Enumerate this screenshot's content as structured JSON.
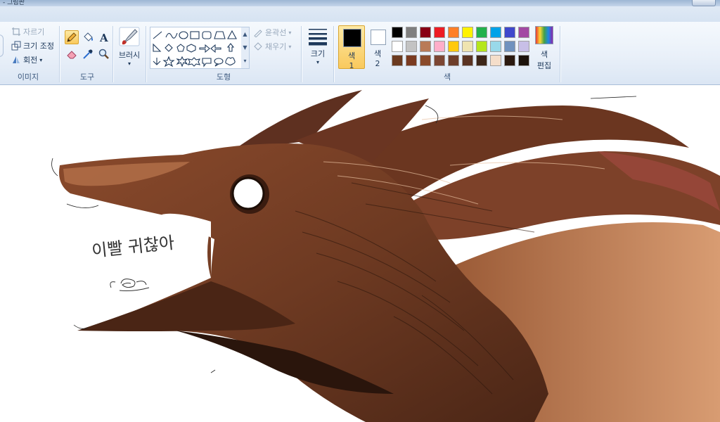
{
  "window": {
    "title": "- 그림판"
  },
  "ribbon": {
    "image_group": {
      "label": "이미지",
      "crop": "자르기",
      "resize": "크기 조정",
      "rotate": "회전"
    },
    "tools_group": {
      "label": "도구"
    },
    "brush": {
      "label": "브러시"
    },
    "shapes_group": {
      "label": "도형",
      "outline": "윤곽선",
      "fill": "채우기"
    },
    "size": {
      "label": "크기"
    },
    "colors_group": {
      "label": "색",
      "color1_label": "색",
      "color1_num": "1",
      "color2_label": "색",
      "color2_num": "2",
      "edit_label": "색",
      "edit_label2": "편집",
      "color1": "#000000",
      "color2": "#ffffff",
      "palette": [
        [
          "#000000",
          "#7f7f7f",
          "#880015",
          "#ed1c24",
          "#ff7f27",
          "#fff200",
          "#22b14c",
          "#00a2e8",
          "#3f48cc",
          "#a349a4"
        ],
        [
          "#ffffff",
          "#c3c3c3",
          "#b97a57",
          "#ffaec9",
          "#ffc90e",
          "#efe4b0",
          "#b5e61d",
          "#99d9ea",
          "#7092be",
          "#c8bfe7"
        ],
        [
          "#6b3a1f",
          "#7a3a20",
          "#8a4a2a",
          "#7c4633",
          "#6e3e2a",
          "#5a3322",
          "#3d2618",
          "#f5deca",
          "#2b1a10",
          "#1c120b"
        ]
      ]
    }
  },
  "canvas": {
    "note_line1": "이빨 귀찮아",
    "note_line2": "",
    "colors": {
      "fur_dark": "#3b1f12",
      "fur_mid": "#7a4027",
      "fur_light": "#a8633d",
      "skin": "#d49a70"
    }
  }
}
